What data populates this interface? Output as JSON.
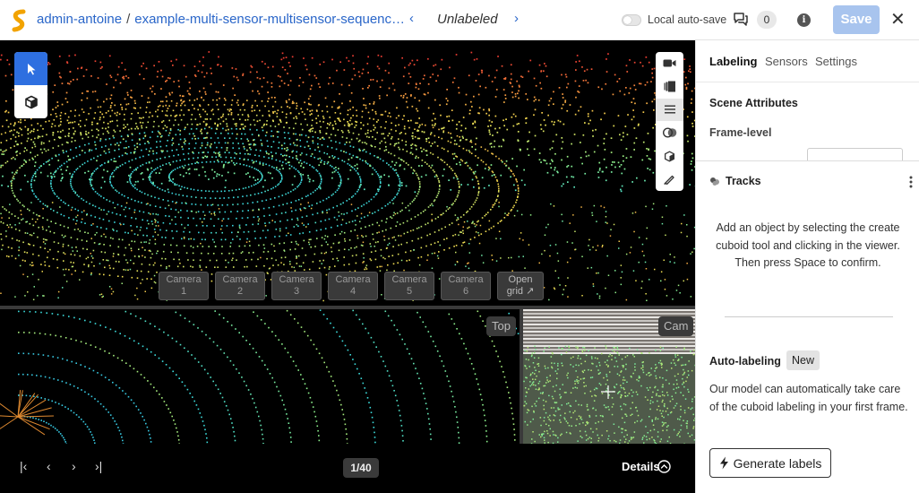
{
  "header": {
    "org": "admin-antoine",
    "separator": "/",
    "dataset": "example-multi-sensor-multisensor-sequenc…",
    "prev_arrow": "‹",
    "next_arrow": "›",
    "status": "Unlabeled",
    "autosave_label": "Local auto-save",
    "autosave_on": false,
    "comment_count": "0",
    "info_glyph": "i",
    "save_label": "Save",
    "close_glyph": "✕"
  },
  "viewer": {
    "cameras": [
      {
        "line1": "Camera",
        "line2": "1"
      },
      {
        "line1": "Camera",
        "line2": "2"
      },
      {
        "line1": "Camera",
        "line2": "3"
      },
      {
        "line1": "Camera",
        "line2": "4"
      },
      {
        "line1": "Camera",
        "line2": "5"
      },
      {
        "line1": "Camera",
        "line2": "6"
      }
    ],
    "open_grid": {
      "line1": "Open",
      "line2": "grid ↗"
    },
    "top_view_label": "Top",
    "cam_view_label": "Cam",
    "timeline": {
      "first": "|‹",
      "prev": "‹",
      "next": "›",
      "last": "›|",
      "frame": "1/40",
      "details": "Details"
    }
  },
  "panel": {
    "tabs": [
      "Labeling",
      "Sensors",
      "Settings"
    ],
    "scene_attributes": "Scene Attributes",
    "frame_level": "Frame-level",
    "tracks": "Tracks",
    "empty_message": "Add an object by selecting the create cuboid tool and clicking in the viewer. Then press Space to confirm.",
    "auto_labeling": "Auto-labeling",
    "new_badge": "New",
    "auto_description": "Our model can automatically take care of the cuboid labeling in your first frame.",
    "generate_label": "Generate labels"
  },
  "colors": {
    "accent": "#2e6fe0",
    "link": "#2a66c9",
    "save_disabled": "#a8c4ee",
    "viewer_bg": "#000000"
  }
}
